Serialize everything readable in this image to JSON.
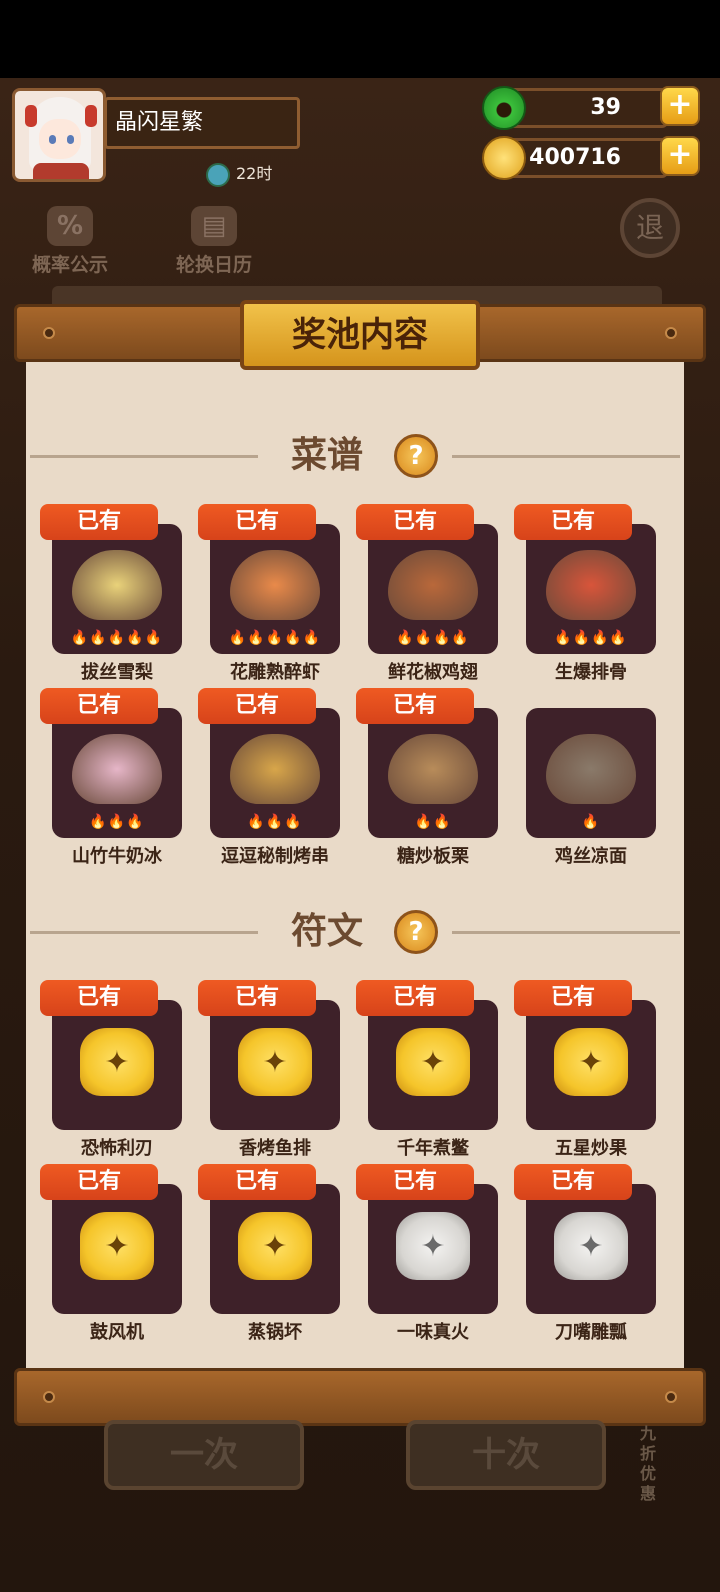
{
  "player": {
    "name": "晶闪星繁",
    "timer": "22时"
  },
  "currencies": {
    "jade": "39",
    "coins": "400716"
  },
  "hud": {
    "probability": "概率公示",
    "calendar": "轮换日历",
    "exit": "退"
  },
  "modal": {
    "title": "奖池内容"
  },
  "sections": {
    "recipes": "菜谱",
    "runes": "符文",
    "help": "?"
  },
  "owned_label": "已有",
  "recipes": [
    {
      "name": "拔丝雪梨",
      "owned": true,
      "flames": 5
    },
    {
      "name": "花雕熟醉虾",
      "owned": true,
      "flames": 5
    },
    {
      "name": "鲜花椒鸡翅",
      "owned": true,
      "flames": 4
    },
    {
      "name": "生爆排骨",
      "owned": true,
      "flames": 4
    },
    {
      "name": "山竹牛奶冰",
      "owned": true,
      "flames": 3
    },
    {
      "name": "逗逗秘制烤串",
      "owned": true,
      "flames": 3
    },
    {
      "name": "糖炒板栗",
      "owned": true,
      "flames": 2
    },
    {
      "name": "鸡丝凉面",
      "owned": false,
      "flames": 1
    }
  ],
  "runes": [
    {
      "name": "恐怖利刃",
      "owned": true,
      "tier": "gold"
    },
    {
      "name": "香烤鱼排",
      "owned": true,
      "tier": "gold"
    },
    {
      "name": "千年煮鳖",
      "owned": true,
      "tier": "gold"
    },
    {
      "name": "五星炒果",
      "owned": true,
      "tier": "gold"
    },
    {
      "name": "鼓风机",
      "owned": true,
      "tier": "gold"
    },
    {
      "name": "蒸锅坏",
      "owned": true,
      "tier": "gold"
    },
    {
      "name": "一味真火",
      "owned": true,
      "tier": "silver"
    },
    {
      "name": "刀嘴雕瓢",
      "owned": true,
      "tier": "silver"
    }
  ],
  "bottom": {
    "single": "一次",
    "ten": "十次",
    "discount": "九折优惠"
  },
  "colors": {
    "badge": "#e04d1e",
    "card": "#3e2129",
    "paper": "#e9dac8",
    "gold_rune": "#f5c52a",
    "silver_rune": "#d8d6d2"
  }
}
